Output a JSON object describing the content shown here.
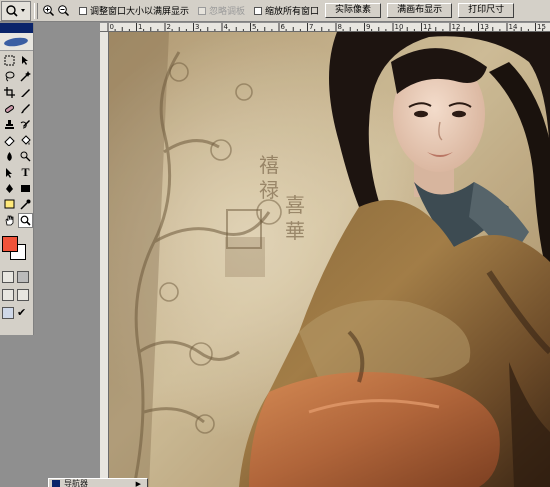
{
  "options_bar": {
    "tool_preset_icon": "zoom-icon",
    "zoom_in_icon": "zoom-in-icon",
    "zoom_out_icon": "zoom-out-icon",
    "options": [
      {
        "label": "调整窗口大小以满屏显示",
        "checked": false,
        "enabled": true
      },
      {
        "label": "忽略调板",
        "checked": false,
        "enabled": false
      },
      {
        "label": "缩放所有窗口",
        "checked": false,
        "enabled": true
      }
    ],
    "buttons": [
      "实际像素",
      "满画布显示",
      "打印尺寸"
    ]
  },
  "toolbox": {
    "foreground_color": "#f0533a",
    "background_color": "#ffffff",
    "type_tool_glyph": "T"
  },
  "ruler": {
    "labels": [
      "0",
      "1",
      "2",
      "3",
      "4",
      "5",
      "6",
      "7",
      "8",
      "9",
      "10",
      "11",
      "12",
      "13",
      "14",
      "15"
    ]
  },
  "canvas": {
    "description": "portrait photo of a woman in a bronze silk robe against an ink-painted wall"
  },
  "palette_tab": {
    "label": "导航器"
  }
}
